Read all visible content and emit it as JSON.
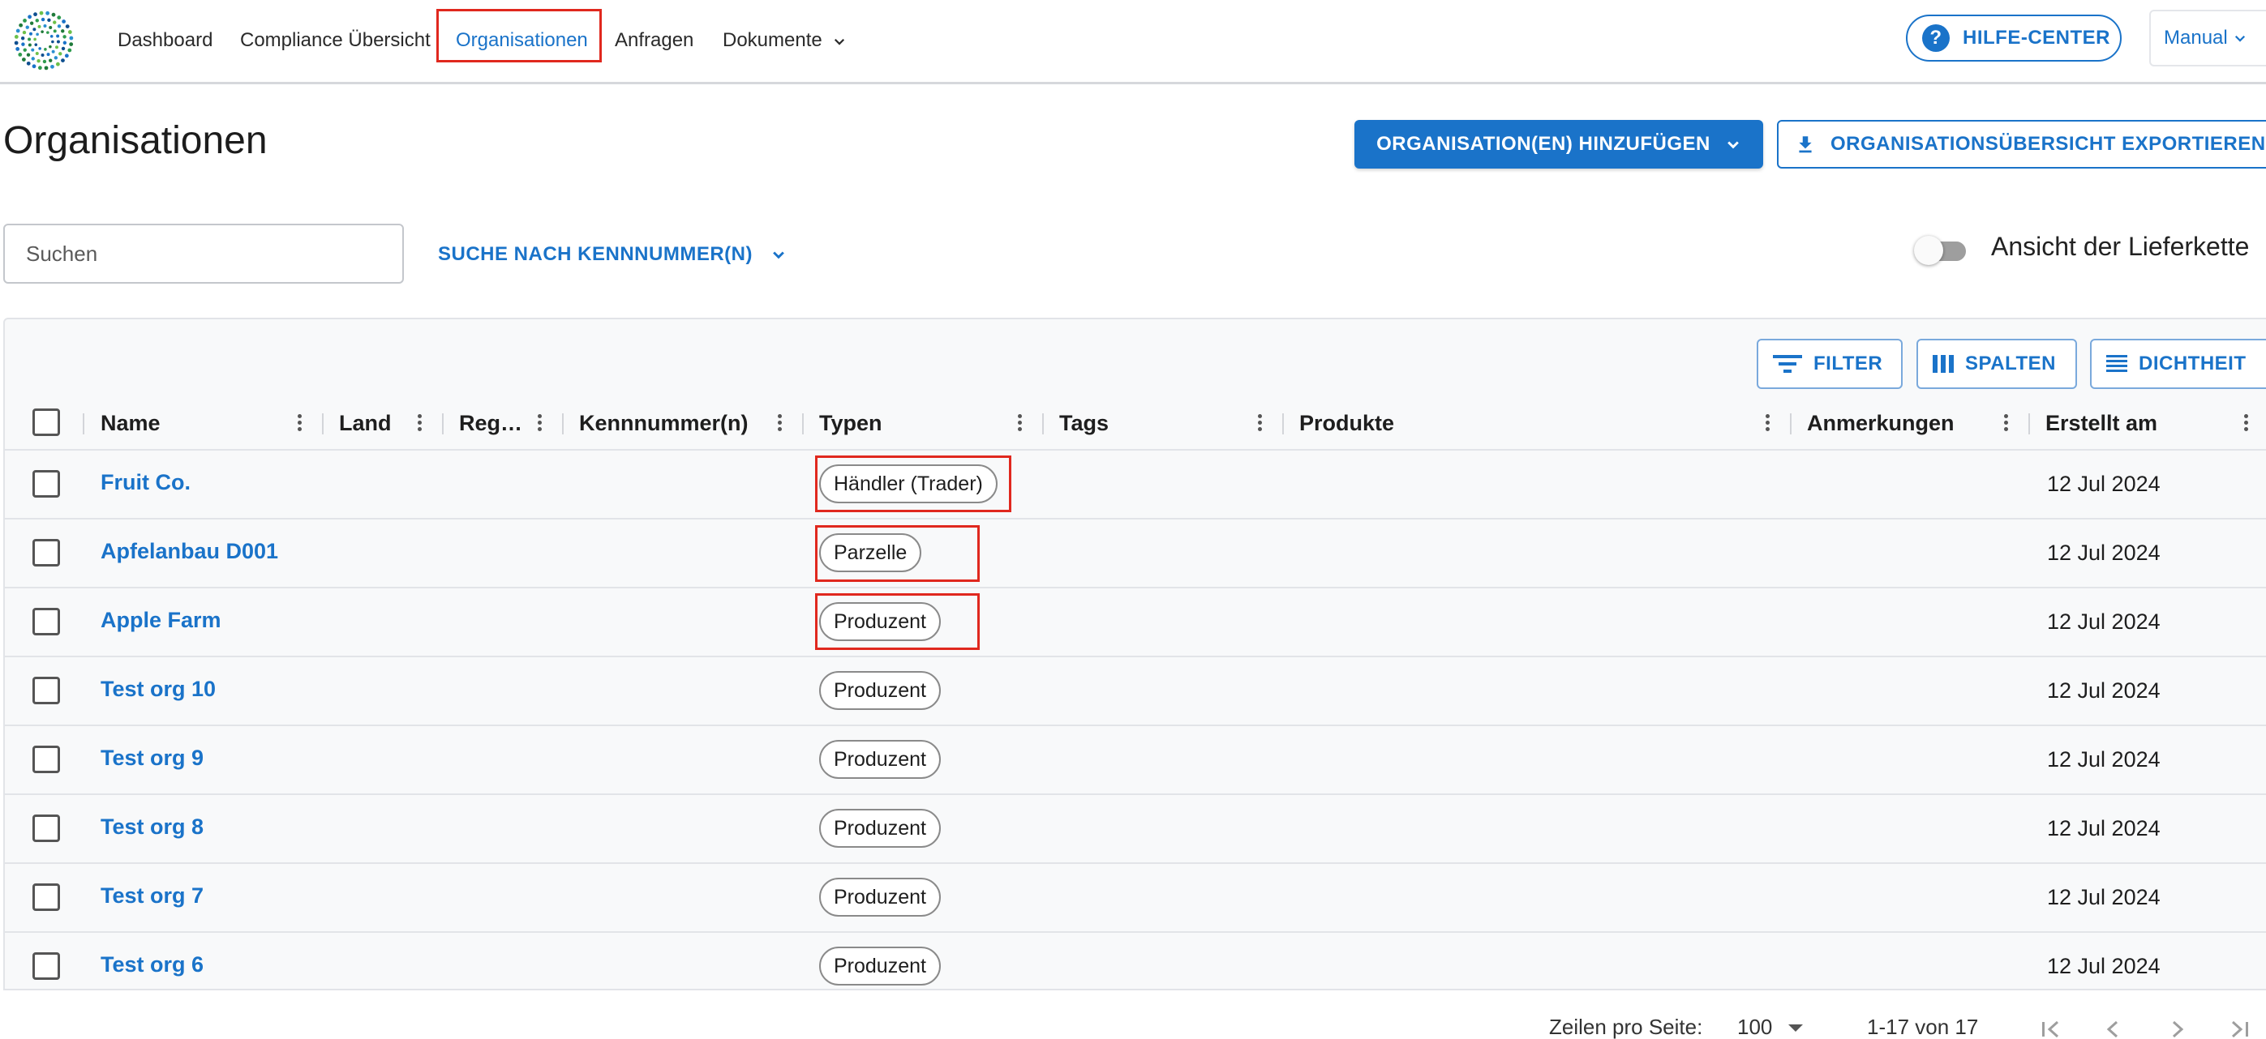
{
  "nav": {
    "items": [
      {
        "label": "Dashboard"
      },
      {
        "label": "Compliance Übersicht"
      },
      {
        "label": "Organisationen"
      },
      {
        "label": "Anfragen"
      },
      {
        "label": "Dokumente"
      }
    ],
    "help_label": "HILFE-CENTER",
    "manual_label": "Manual"
  },
  "page": {
    "title": "Organisationen",
    "add_button": "ORGANISATION(EN) HINZUFÜGEN",
    "export_button": "ORGANISATIONSÜBERSICHT EXPORTIEREN"
  },
  "search": {
    "placeholder": "Suchen",
    "id_search_label": "SUCHE NACH KENNNUMMER(N)",
    "toggle_label": "Ansicht der Lieferkette"
  },
  "toolbar": {
    "filter": "FILTER",
    "columns": "SPALTEN",
    "density": "DICHTHEIT"
  },
  "table": {
    "columns": [
      "Name",
      "Land",
      "Reg…",
      "Kennnummer(n)",
      "Typen",
      "Tags",
      "Produkte",
      "Anmerkungen",
      "Erstellt am"
    ],
    "rows": [
      {
        "name": "Fruit Co.",
        "type": "Händler (Trader)",
        "created": "12 Jul 2024"
      },
      {
        "name": "Apfelanbau D001",
        "type": "Parzelle",
        "created": "12 Jul 2024"
      },
      {
        "name": "Apple Farm",
        "type": "Produzent",
        "created": "12 Jul 2024"
      },
      {
        "name": "Test org 10",
        "type": "Produzent",
        "created": "12 Jul 2024"
      },
      {
        "name": "Test org 9",
        "type": "Produzent",
        "created": "12 Jul 2024"
      },
      {
        "name": "Test org 8",
        "type": "Produzent",
        "created": "12 Jul 2024"
      },
      {
        "name": "Test org 7",
        "type": "Produzent",
        "created": "12 Jul 2024"
      },
      {
        "name": "Test org 6",
        "type": "Produzent",
        "created": "12 Jul 2024"
      }
    ]
  },
  "pagination": {
    "rows_per_page_label": "Zeilen pro Seite:",
    "rows_per_page": "100",
    "range": "1-17 von 17"
  },
  "colors": {
    "accent": "#1a73c9",
    "highlight": "#e0281e"
  }
}
